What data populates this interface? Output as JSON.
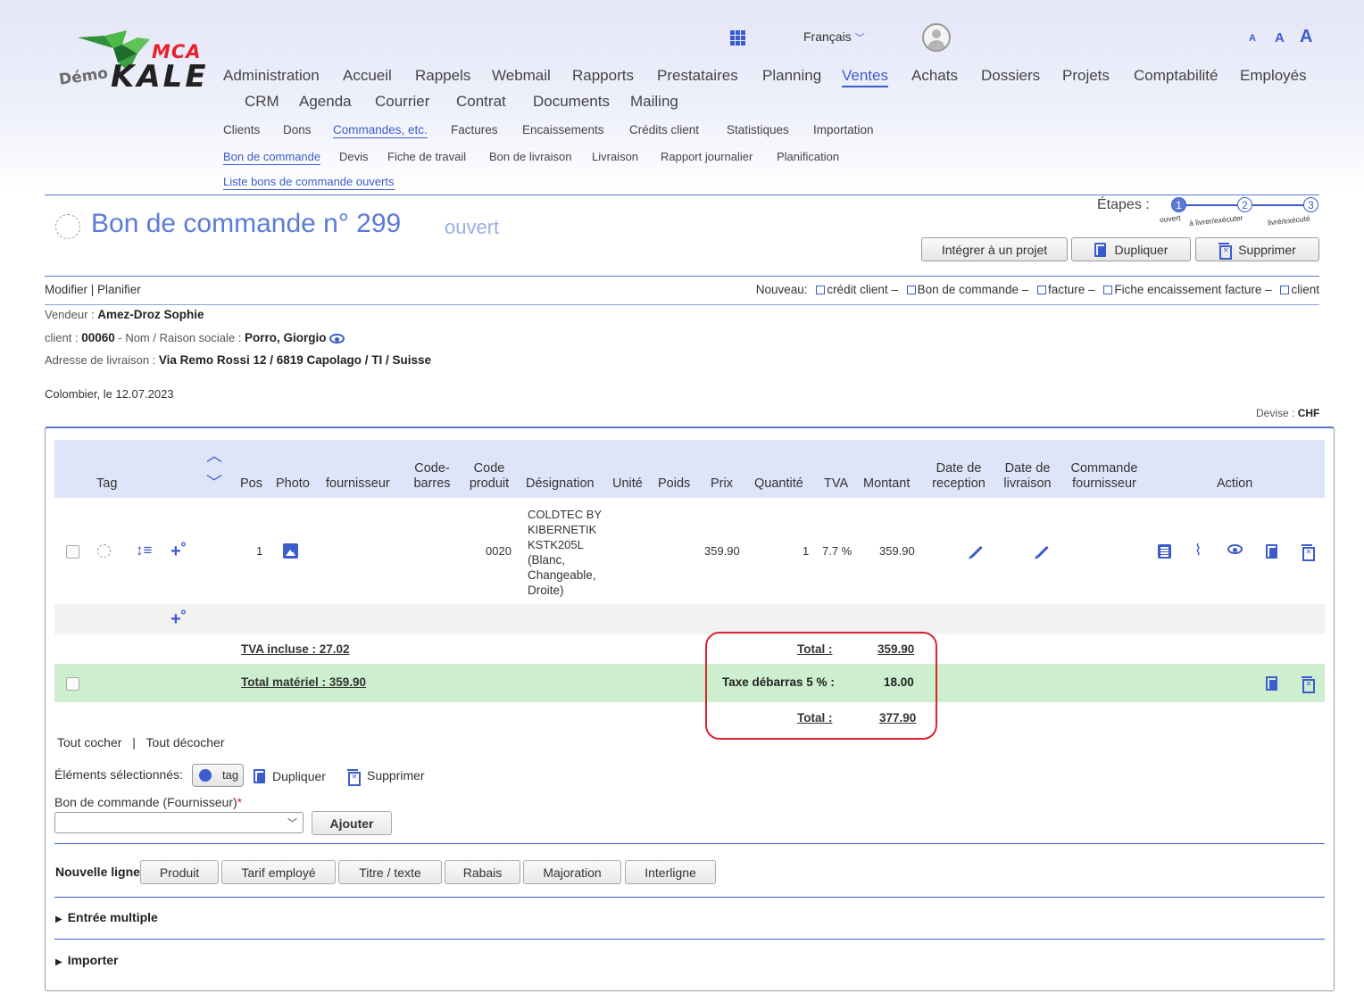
{
  "logo": {
    "demo": "Démo",
    "mca": "MCA",
    "kale": "KALE"
  },
  "topbar": {
    "language": "Français",
    "font_sizes": [
      "A",
      "A",
      "A"
    ]
  },
  "menu_main": [
    "Administration",
    "Accueil",
    "Rappels",
    "Webmail",
    "Rapports",
    "Prestataires",
    "Planning",
    "Ventes",
    "Achats",
    "Dossiers",
    "Projets",
    "Comptabilité",
    "Employés"
  ],
  "menu_main2": [
    "CRM",
    "Agenda",
    "Courrier",
    "Contrat",
    "Documents",
    "Mailing"
  ],
  "menu_sub": [
    "Clients",
    "Dons",
    "Commandes, etc.",
    "Factures",
    "Encaissements",
    "Crédits client",
    "Statistiques",
    "Importation"
  ],
  "menu_sub2": [
    "Bon de commande",
    "Devis",
    "Fiche de travail",
    "Bon de livraison",
    "Livraison",
    "Rapport journalier",
    "Planification"
  ],
  "menu_sub3": "Liste bons de commande ouverts",
  "page": {
    "title": "Bon de commande n° 299",
    "status": "ouvert",
    "steps_label": "Étapes :",
    "steps": [
      {
        "num": "1",
        "label": "ouvert"
      },
      {
        "num": "2",
        "label": "à livrer/exécuter"
      },
      {
        "num": "3",
        "label": "livré/exécuté"
      }
    ],
    "buttons": {
      "integrate": "Intégrer à un projet",
      "duplicate": "Dupliquer",
      "delete": "Supprimer"
    }
  },
  "actions_bar": {
    "left": "Modifier | Planifier",
    "new_label": "Nouveau:",
    "new_links": [
      "crédit client",
      "Bon de commande",
      "facture",
      "Fiche encaissement facture",
      "client"
    ],
    "sep": "–"
  },
  "info": {
    "vendeur_label": "Vendeur :",
    "vendeur": "Amez-Droz Sophie",
    "client_label": "client :",
    "client_no": "00060",
    "nom_label": "- Nom / Raison sociale :",
    "client_name": "Porro, Giorgio",
    "adresse_label": "Adresse de livraison :",
    "adresse": "Via Remo Rossi 12 / 6819 Capolago / TI / Suisse",
    "date_line": "Colombier, le 12.07.2023",
    "devise_label": "Devise :",
    "devise": "CHF"
  },
  "table": {
    "headers": {
      "tag": "Tag",
      "pos": "Pos",
      "photo": "Photo",
      "fournisseur": "fournisseur",
      "codebarres_1": "Code-",
      "codebarres_2": "barres",
      "codeproduit_1": "Code",
      "codeproduit_2": "produit",
      "designation": "Désignation",
      "unite": "Unité",
      "poids": "Poids",
      "prix": "Prix",
      "quantite": "Quantité",
      "tva": "TVA",
      "montant": "Montant",
      "reception_1": "Date de",
      "reception_2": "reception",
      "livraison_1": "Date de",
      "livraison_2": "livraison",
      "cmdfourn_1": "Commande",
      "cmdfourn_2": "fournisseur",
      "action": "Action"
    },
    "row": {
      "pos": "1",
      "code_produit": "0020",
      "designation": [
        "COLDTEC BY",
        "KIBERNETIK",
        "KSTK205L",
        "(Blanc,",
        "Changeable,",
        "Droite)"
      ],
      "prix": "359.90",
      "quantite": "1",
      "tva": "7.7 %",
      "montant": "359.90"
    },
    "tva_incluse": "TVA incluse : 27.02",
    "total_label": "Total :",
    "total_value": "359.90",
    "total_materiel": "Total matériel : 359.90",
    "taxe_label": "Taxe débarras 5 % :",
    "taxe_value": "18.00",
    "total2_label": "Total :",
    "total2_value": "377.90"
  },
  "bottom": {
    "check_all": "Tout cocher",
    "uncheck_all": "Tout décocher",
    "separator": "|",
    "selected_label": "Éléments sélectionnés:",
    "tag": "tag",
    "duplicate": "Dupliquer",
    "delete": "Supprimer",
    "supplier_order_label": "Bon de commande (Fournisseur)",
    "required_mark": "*",
    "add_button": "Ajouter",
    "new_line_label": "Nouvelle ligne",
    "new_line_buttons": [
      "Produit",
      "Tarif employé",
      "Titre / texte",
      "Rabais",
      "Majoration",
      "Interligne"
    ],
    "multiple_entry": "Entrée multiple",
    "import": "Importer"
  },
  "colors": {
    "accent": "#3b5ccc",
    "header_bg": "#dfe5f8",
    "total_row_bg": "#cdeecf",
    "highlight": "#d8262c"
  }
}
